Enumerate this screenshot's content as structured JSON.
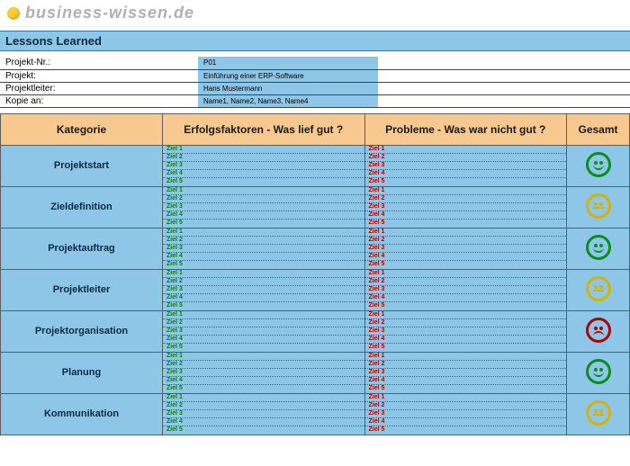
{
  "brand": "business-wissen.de",
  "title": "Lessons Learned",
  "meta": {
    "rows": [
      {
        "label": "Projekt-Nr.:",
        "value": "P01"
      },
      {
        "label": "Projekt:",
        "value": "Einführung einer ERP-Software"
      },
      {
        "label": "Projektleiter:",
        "value": "Hans Mustermann"
      },
      {
        "label": "Kopie an:",
        "value": "Name1, Name2, Name3, Name4"
      }
    ]
  },
  "table": {
    "headers": {
      "kategorie": "Kategorie",
      "erfolg": "Erfolgsfaktoren - Was lief gut ?",
      "probleme": "Probleme - Was war nicht gut ?",
      "gesamt": "Gesamt"
    },
    "ziele": [
      "Ziel 1",
      "Ziel 2",
      "Ziel 3",
      "Ziel 4",
      "Ziel 5"
    ],
    "rows": [
      {
        "kategorie": "Projektstart",
        "status": "happy"
      },
      {
        "kategorie": "Zieldefinition",
        "status": "neutral"
      },
      {
        "kategorie": "Projektauftrag",
        "status": "happy"
      },
      {
        "kategorie": "Projektleiter",
        "status": "neutral"
      },
      {
        "kategorie": "Projektorganisation",
        "status": "sad"
      },
      {
        "kategorie": "Planung",
        "status": "happy"
      },
      {
        "kategorie": "Kommunikation",
        "status": "neutral"
      }
    ]
  },
  "icons": {
    "happy": "smiley-happy-icon",
    "neutral": "smiley-neutral-icon",
    "sad": "smiley-sad-icon"
  }
}
